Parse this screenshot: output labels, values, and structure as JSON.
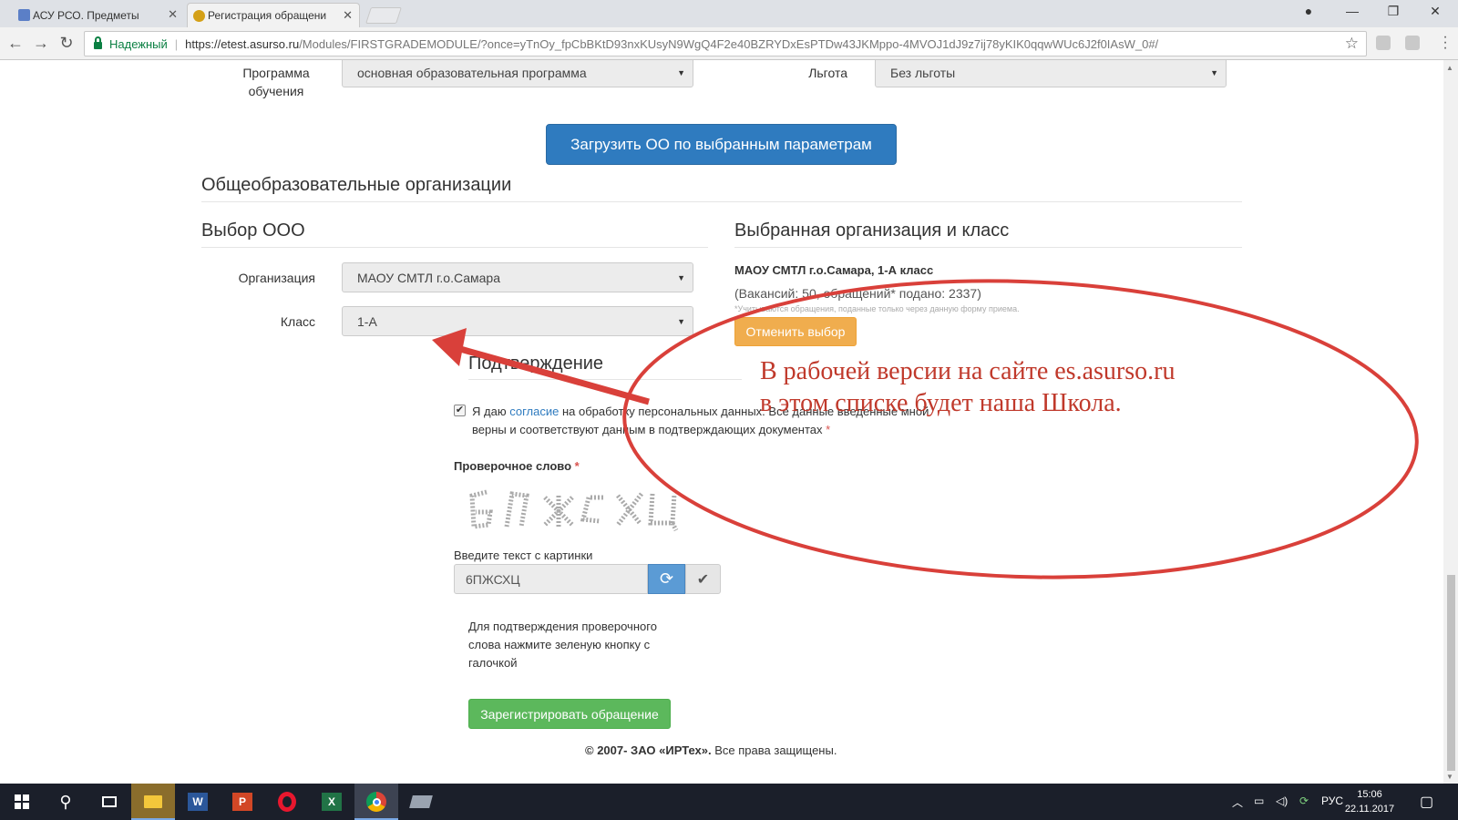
{
  "browser": {
    "tabs": [
      {
        "title": "АСУ РСО. Предметы",
        "active": false
      },
      {
        "title": "Регистрация обращени",
        "active": true
      }
    ],
    "security_label": "Надежный",
    "url_host": "https://etest.asurso.ru",
    "url_rest": "/Modules/FIRSTGRADEMODULE/?once=yTnOy_fpCbBKtD93nxKUsyN9WgQ4F2e40BZRYDxEsPTDw43JKMppo-4MVOJ1dJ9z7ij78yKIK0qqwWUc6J2f0IAsW_0#/"
  },
  "form": {
    "program_label": "Программа обучения",
    "program_value": "основная образовательная программа",
    "benefit_label": "Льгота",
    "benefit_value": "Без льготы",
    "load_button": "Загрузить ОО по выбранным параметрам",
    "section_title": "Общеобразовательные организации",
    "choose_title": "Выбор ООО",
    "org_label": "Организация",
    "org_value": "МАОУ СМТЛ г.о.Самара",
    "class_label": "Класс",
    "class_value": "1-А",
    "selected_title": "Выбранная организация и класс",
    "selected_org": "МАОУ СМТЛ г.о.Самара, 1-А класс",
    "vacancies": "(Вакансий: 50, обращений* подано: 2337)",
    "vacancies_note": "*Учитываются обращения, поданные только через данную форму приема.",
    "cancel_button": "Отменить выбор",
    "confirm_title": "Подтверждение",
    "consent_pre": "Я даю ",
    "consent_link": "согласие",
    "consent_post": " на обработку персональных данных. Все данные введенные мной верны и соответствуют данным в подтверждающих документах ",
    "required_mark": "*",
    "captcha_label": "Проверочное слово",
    "captcha_input_label": "Введите текст с картинки",
    "captcha_value": "6ПЖСХЦ",
    "hint": "Для подтверждения проверочного слова нажмите зеленую кнопку с галочкой",
    "register_button": "Зарегистрировать обращение"
  },
  "footer": {
    "copyright": "© 2007- ЗАО «ИРТех».",
    "rights": " Все права защищены."
  },
  "annotation": {
    "line1": "В рабочей версии на сайте es.asurso.ru",
    "line2": "в этом списке будет наша Школа.",
    "color": "#c0392b"
  },
  "taskbar": {
    "language": "РУС",
    "time": "15:06",
    "date": "22.11.2017"
  },
  "colors": {
    "primary": "#2f7bbf",
    "warning": "#f0ad4e",
    "success": "#5cb85c"
  }
}
